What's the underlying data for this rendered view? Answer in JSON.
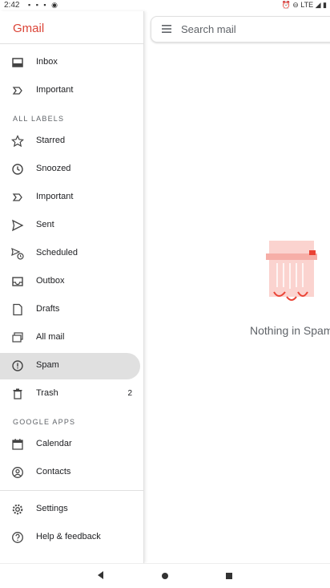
{
  "status": {
    "time": "2:42",
    "right": "LTE"
  },
  "app": {
    "logo": "Gmail"
  },
  "search": {
    "placeholder": "Search mail"
  },
  "empty": {
    "text": "Nothing in Spam"
  },
  "drawer": {
    "top_items": [
      {
        "label": "Inbox",
        "icon": "inbox-icon"
      },
      {
        "label": "Important",
        "icon": "important-icon"
      }
    ],
    "all_labels_header": "ALL LABELS",
    "labels": [
      {
        "label": "Starred",
        "icon": "star-icon"
      },
      {
        "label": "Snoozed",
        "icon": "clock-icon"
      },
      {
        "label": "Important",
        "icon": "important-icon"
      },
      {
        "label": "Sent",
        "icon": "send-icon"
      },
      {
        "label": "Scheduled",
        "icon": "scheduled-icon"
      },
      {
        "label": "Outbox",
        "icon": "outbox-icon"
      },
      {
        "label": "Drafts",
        "icon": "draft-icon"
      },
      {
        "label": "All mail",
        "icon": "all-mail-icon"
      },
      {
        "label": "Spam",
        "icon": "spam-icon",
        "active": true
      },
      {
        "label": "Trash",
        "icon": "trash-icon",
        "count": "2"
      }
    ],
    "google_apps_header": "GOOGLE APPS",
    "apps": [
      {
        "label": "Calendar",
        "icon": "calendar-icon"
      },
      {
        "label": "Contacts",
        "icon": "contacts-icon"
      }
    ],
    "bottom": [
      {
        "label": "Settings",
        "icon": "gear-icon"
      },
      {
        "label": "Help & feedback",
        "icon": "help-icon"
      }
    ]
  },
  "colors": {
    "brand": "#db4437",
    "active_bg": "#e0e0e0"
  }
}
